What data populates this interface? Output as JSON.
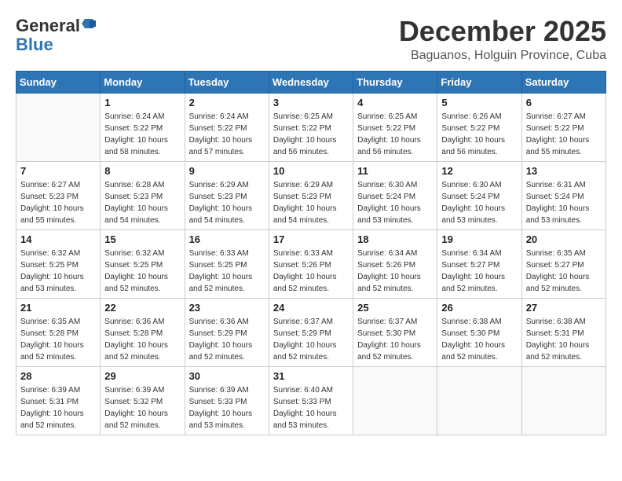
{
  "logo": {
    "general": "General",
    "blue": "Blue"
  },
  "title": {
    "month_year": "December 2025",
    "location": "Baguanos, Holguin Province, Cuba"
  },
  "weekdays": [
    "Sunday",
    "Monday",
    "Tuesday",
    "Wednesday",
    "Thursday",
    "Friday",
    "Saturday"
  ],
  "weeks": [
    [
      {
        "day": "",
        "sunrise": "",
        "sunset": "",
        "daylight": ""
      },
      {
        "day": "1",
        "sunrise": "Sunrise: 6:24 AM",
        "sunset": "Sunset: 5:22 PM",
        "daylight": "Daylight: 10 hours and 58 minutes."
      },
      {
        "day": "2",
        "sunrise": "Sunrise: 6:24 AM",
        "sunset": "Sunset: 5:22 PM",
        "daylight": "Daylight: 10 hours and 57 minutes."
      },
      {
        "day": "3",
        "sunrise": "Sunrise: 6:25 AM",
        "sunset": "Sunset: 5:22 PM",
        "daylight": "Daylight: 10 hours and 56 minutes."
      },
      {
        "day": "4",
        "sunrise": "Sunrise: 6:25 AM",
        "sunset": "Sunset: 5:22 PM",
        "daylight": "Daylight: 10 hours and 56 minutes."
      },
      {
        "day": "5",
        "sunrise": "Sunrise: 6:26 AM",
        "sunset": "Sunset: 5:22 PM",
        "daylight": "Daylight: 10 hours and 56 minutes."
      },
      {
        "day": "6",
        "sunrise": "Sunrise: 6:27 AM",
        "sunset": "Sunset: 5:22 PM",
        "daylight": "Daylight: 10 hours and 55 minutes."
      }
    ],
    [
      {
        "day": "7",
        "sunrise": "Sunrise: 6:27 AM",
        "sunset": "Sunset: 5:23 PM",
        "daylight": "Daylight: 10 hours and 55 minutes."
      },
      {
        "day": "8",
        "sunrise": "Sunrise: 6:28 AM",
        "sunset": "Sunset: 5:23 PM",
        "daylight": "Daylight: 10 hours and 54 minutes."
      },
      {
        "day": "9",
        "sunrise": "Sunrise: 6:29 AM",
        "sunset": "Sunset: 5:23 PM",
        "daylight": "Daylight: 10 hours and 54 minutes."
      },
      {
        "day": "10",
        "sunrise": "Sunrise: 6:29 AM",
        "sunset": "Sunset: 5:23 PM",
        "daylight": "Daylight: 10 hours and 54 minutes."
      },
      {
        "day": "11",
        "sunrise": "Sunrise: 6:30 AM",
        "sunset": "Sunset: 5:24 PM",
        "daylight": "Daylight: 10 hours and 53 minutes."
      },
      {
        "day": "12",
        "sunrise": "Sunrise: 6:30 AM",
        "sunset": "Sunset: 5:24 PM",
        "daylight": "Daylight: 10 hours and 53 minutes."
      },
      {
        "day": "13",
        "sunrise": "Sunrise: 6:31 AM",
        "sunset": "Sunset: 5:24 PM",
        "daylight": "Daylight: 10 hours and 53 minutes."
      }
    ],
    [
      {
        "day": "14",
        "sunrise": "Sunrise: 6:32 AM",
        "sunset": "Sunset: 5:25 PM",
        "daylight": "Daylight: 10 hours and 53 minutes."
      },
      {
        "day": "15",
        "sunrise": "Sunrise: 6:32 AM",
        "sunset": "Sunset: 5:25 PM",
        "daylight": "Daylight: 10 hours and 52 minutes."
      },
      {
        "day": "16",
        "sunrise": "Sunrise: 6:33 AM",
        "sunset": "Sunset: 5:25 PM",
        "daylight": "Daylight: 10 hours and 52 minutes."
      },
      {
        "day": "17",
        "sunrise": "Sunrise: 6:33 AM",
        "sunset": "Sunset: 5:26 PM",
        "daylight": "Daylight: 10 hours and 52 minutes."
      },
      {
        "day": "18",
        "sunrise": "Sunrise: 6:34 AM",
        "sunset": "Sunset: 5:26 PM",
        "daylight": "Daylight: 10 hours and 52 minutes."
      },
      {
        "day": "19",
        "sunrise": "Sunrise: 6:34 AM",
        "sunset": "Sunset: 5:27 PM",
        "daylight": "Daylight: 10 hours and 52 minutes."
      },
      {
        "day": "20",
        "sunrise": "Sunrise: 6:35 AM",
        "sunset": "Sunset: 5:27 PM",
        "daylight": "Daylight: 10 hours and 52 minutes."
      }
    ],
    [
      {
        "day": "21",
        "sunrise": "Sunrise: 6:35 AM",
        "sunset": "Sunset: 5:28 PM",
        "daylight": "Daylight: 10 hours and 52 minutes."
      },
      {
        "day": "22",
        "sunrise": "Sunrise: 6:36 AM",
        "sunset": "Sunset: 5:28 PM",
        "daylight": "Daylight: 10 hours and 52 minutes."
      },
      {
        "day": "23",
        "sunrise": "Sunrise: 6:36 AM",
        "sunset": "Sunset: 5:29 PM",
        "daylight": "Daylight: 10 hours and 52 minutes."
      },
      {
        "day": "24",
        "sunrise": "Sunrise: 6:37 AM",
        "sunset": "Sunset: 5:29 PM",
        "daylight": "Daylight: 10 hours and 52 minutes."
      },
      {
        "day": "25",
        "sunrise": "Sunrise: 6:37 AM",
        "sunset": "Sunset: 5:30 PM",
        "daylight": "Daylight: 10 hours and 52 minutes."
      },
      {
        "day": "26",
        "sunrise": "Sunrise: 6:38 AM",
        "sunset": "Sunset: 5:30 PM",
        "daylight": "Daylight: 10 hours and 52 minutes."
      },
      {
        "day": "27",
        "sunrise": "Sunrise: 6:38 AM",
        "sunset": "Sunset: 5:31 PM",
        "daylight": "Daylight: 10 hours and 52 minutes."
      }
    ],
    [
      {
        "day": "28",
        "sunrise": "Sunrise: 6:39 AM",
        "sunset": "Sunset: 5:31 PM",
        "daylight": "Daylight: 10 hours and 52 minutes."
      },
      {
        "day": "29",
        "sunrise": "Sunrise: 6:39 AM",
        "sunset": "Sunset: 5:32 PM",
        "daylight": "Daylight: 10 hours and 52 minutes."
      },
      {
        "day": "30",
        "sunrise": "Sunrise: 6:39 AM",
        "sunset": "Sunset: 5:33 PM",
        "daylight": "Daylight: 10 hours and 53 minutes."
      },
      {
        "day": "31",
        "sunrise": "Sunrise: 6:40 AM",
        "sunset": "Sunset: 5:33 PM",
        "daylight": "Daylight: 10 hours and 53 minutes."
      },
      {
        "day": "",
        "sunrise": "",
        "sunset": "",
        "daylight": ""
      },
      {
        "day": "",
        "sunrise": "",
        "sunset": "",
        "daylight": ""
      },
      {
        "day": "",
        "sunrise": "",
        "sunset": "",
        "daylight": ""
      }
    ]
  ]
}
